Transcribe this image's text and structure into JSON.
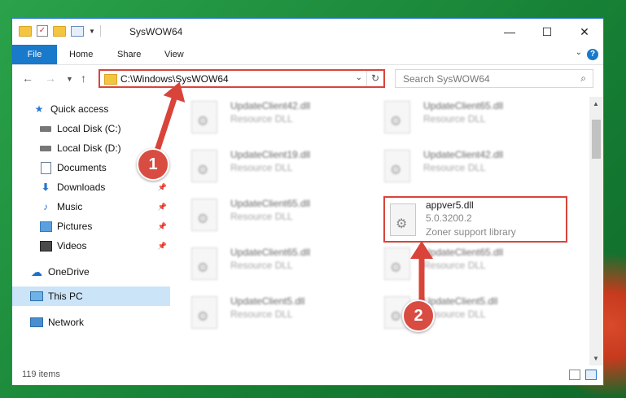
{
  "window": {
    "title": "SysWOW64",
    "controls": {
      "minimize": "—",
      "maximize": "☐",
      "close": "✕"
    }
  },
  "ribbon": {
    "tabs": [
      "File",
      "Home",
      "Share",
      "View"
    ],
    "help": "?"
  },
  "address": {
    "path": "C:\\Windows\\SysWOW64",
    "search_placeholder": "Search SysWOW64"
  },
  "nav": {
    "items": [
      {
        "label": "Quick access"
      },
      {
        "label": "Local Disk (C:)"
      },
      {
        "label": "Local Disk (D:)"
      },
      {
        "label": "Documents"
      },
      {
        "label": "Downloads"
      },
      {
        "label": "Music"
      },
      {
        "label": "Pictures"
      },
      {
        "label": "Videos"
      },
      {
        "label": "OneDrive"
      },
      {
        "label": "This PC"
      },
      {
        "label": "Network"
      }
    ]
  },
  "files": [
    {
      "name": "UpdateClient42.dll",
      "desc": "Resource DLL"
    },
    {
      "name": "UpdateClient65.dll",
      "desc": "Resource DLL"
    },
    {
      "name": "UpdateClient19.dll",
      "desc": "Resource DLL"
    },
    {
      "name": "UpdateClient42.dll",
      "desc": "Resource DLL"
    },
    {
      "name": "UpdateClient65.dll",
      "desc": "Resource DLL"
    },
    {
      "name": "UpdateClient65.dll",
      "desc": "Resource DLL"
    },
    {
      "name": "UpdateClient65.dll",
      "desc": "Resource DLL"
    },
    {
      "name": "UpdateClient5.dll",
      "desc": "Resource DLL"
    },
    {
      "name": "UpdateClient5.dll",
      "desc": "Resource DLL"
    }
  ],
  "highlighted_file": {
    "name": "appver5.dll",
    "version": "5.0.3200.2",
    "company": "Zoner support library"
  },
  "status": {
    "items": "119 items"
  },
  "markers": {
    "one": "1",
    "two": "2"
  },
  "colors": {
    "accent": "#1979ca",
    "annotation": "#d9443a"
  }
}
